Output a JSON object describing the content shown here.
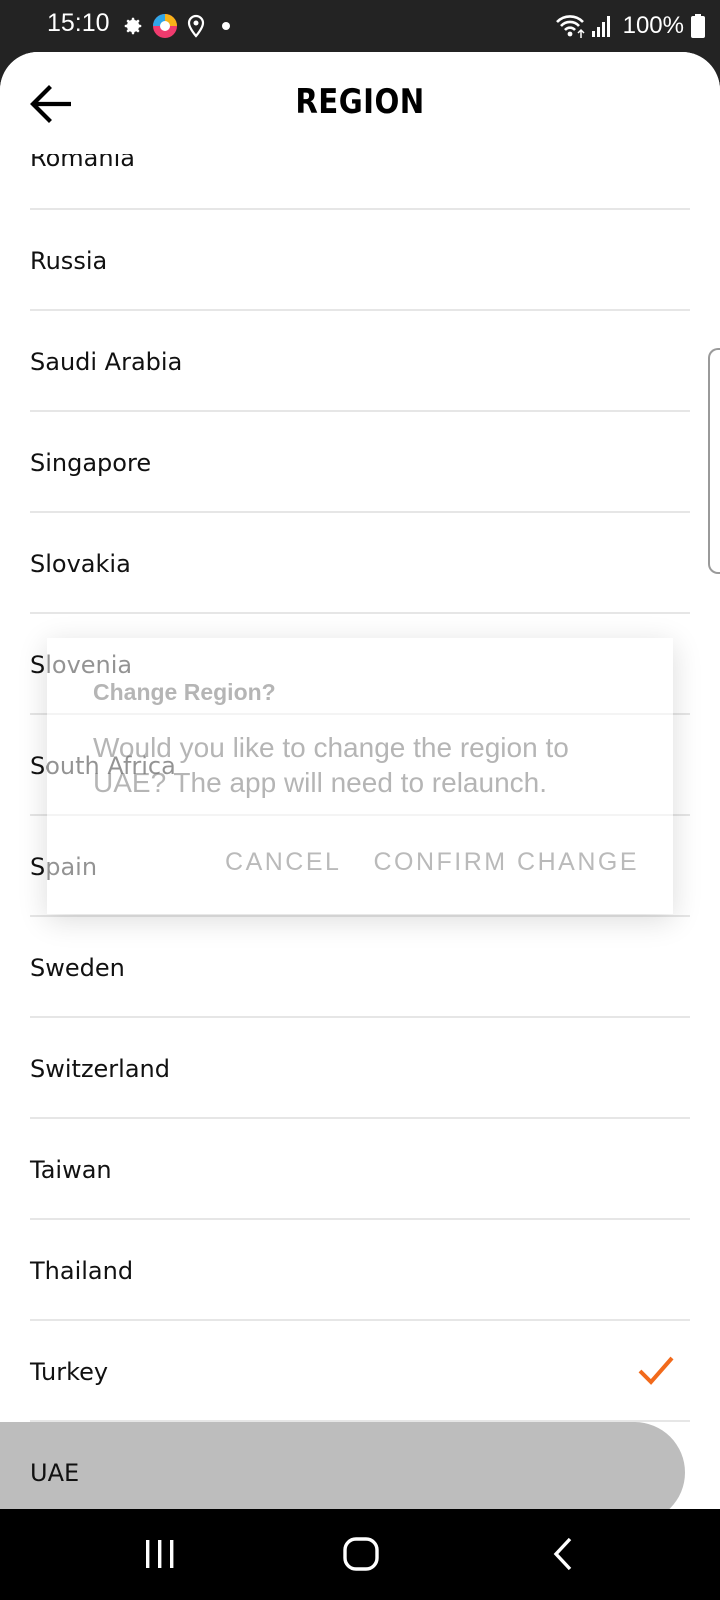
{
  "status_bar": {
    "time": "15:10",
    "battery_text": "100%",
    "left_icons": [
      "settings-icon",
      "app-ball-icon",
      "location-icon",
      "dot-icon"
    ],
    "right_icons": [
      "wifi-icon",
      "signal-icon",
      "battery-icon"
    ]
  },
  "header": {
    "title": "REGION",
    "back_icon": "arrow-left-icon"
  },
  "regions": [
    {
      "label": "Romania"
    },
    {
      "label": "Russia"
    },
    {
      "label": "Saudi Arabia"
    },
    {
      "label": "Singapore"
    },
    {
      "label": "Slovakia"
    },
    {
      "label": "Slovenia"
    },
    {
      "label": "South Africa"
    },
    {
      "label": "Spain"
    },
    {
      "label": "Sweden"
    },
    {
      "label": "Switzerland"
    },
    {
      "label": "Taiwan"
    },
    {
      "label": "Thailand"
    },
    {
      "label": "Turkey",
      "checked": true
    },
    {
      "label": "UAE",
      "pressed": true
    }
  ],
  "dialog": {
    "title": "Change Region?",
    "message": "Would you like to change the region to UAE? The app will need to relaunch.",
    "cancel_label": "CANCEL",
    "confirm_label": "CONFIRM CHANGE"
  },
  "colors": {
    "check": "#f26a1b",
    "pressed_row": "#bdbdbd"
  },
  "nav_bar": [
    "recents-icon",
    "home-icon",
    "back-icon"
  ]
}
